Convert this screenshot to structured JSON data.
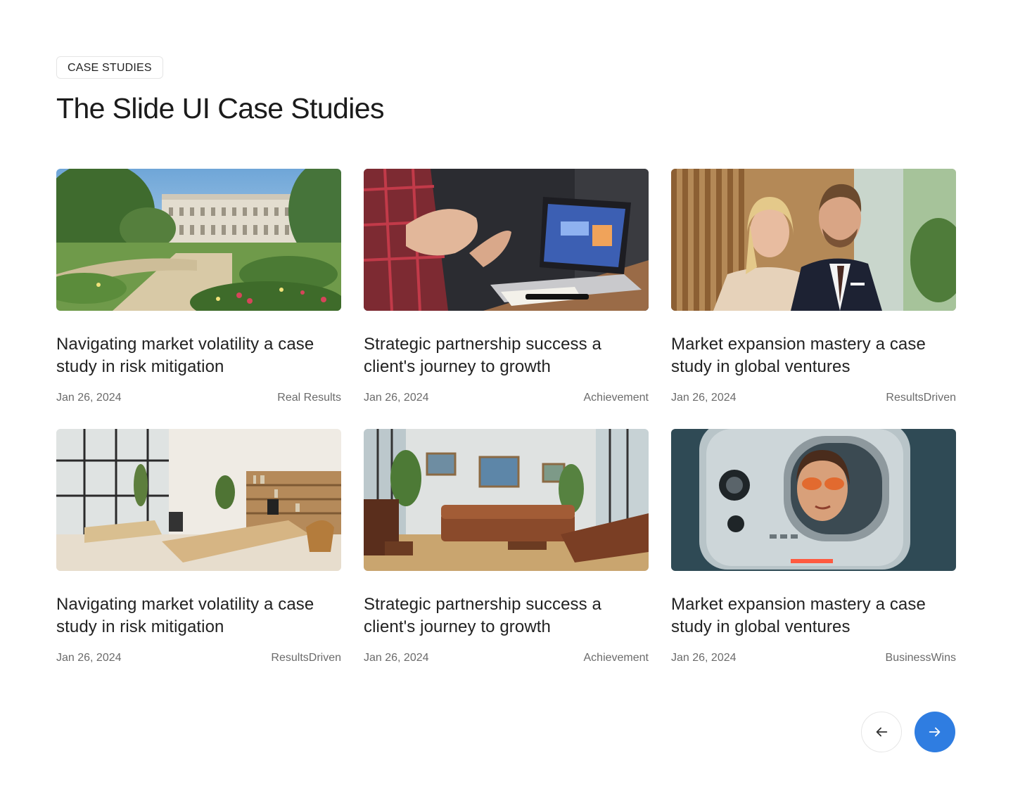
{
  "section": {
    "badge": "CASE STUDIES",
    "title": "The Slide UI Case Studies"
  },
  "cards": [
    {
      "title": "Navigating market volatility a case study in risk mitigation",
      "date": "Jan 26, 2024",
      "tag": "Real Results",
      "image": "palace-garden-image"
    },
    {
      "title": "Strategic partnership success a client's journey to growth",
      "date": "Jan 26, 2024",
      "tag": "Achievement",
      "image": "laptop-meeting-image"
    },
    {
      "title": "Market expansion mastery a case study in global ventures",
      "date": "Jan 26, 2024",
      "tag": "ResultsDriven",
      "image": "business-couple-image"
    },
    {
      "title": "Navigating market volatility a case study in risk mitigation",
      "date": "Jan 26, 2024",
      "tag": "ResultsDriven",
      "image": "bright-office-image"
    },
    {
      "title": "Strategic partnership success a client's journey to growth",
      "date": "Jan 26, 2024",
      "tag": "Achievement",
      "image": "lounge-interior-image"
    },
    {
      "title": "Market expansion mastery a case study in global ventures",
      "date": "Jan 26, 2024",
      "tag": "BusinessWins",
      "image": "retro-robot-image"
    }
  ],
  "pagination": {
    "prev_icon": "arrow-left-icon",
    "next_icon": "arrow-right-icon",
    "accent": "#2f7de1"
  }
}
